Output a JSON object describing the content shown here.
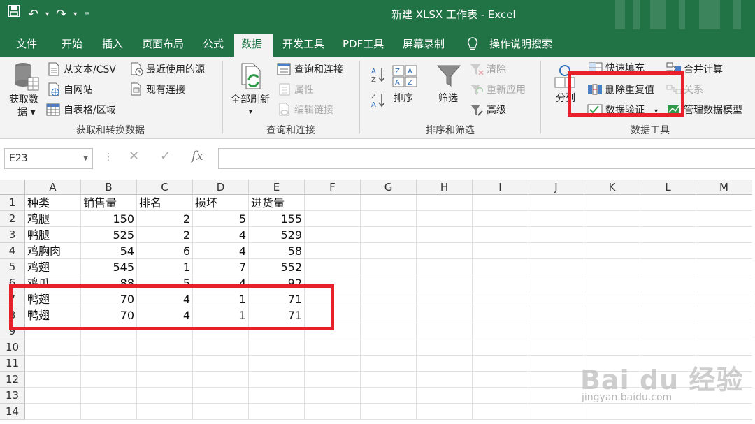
{
  "window": {
    "title": "新建 XLSX 工作表  -  Excel"
  },
  "tabs": [
    {
      "label": "文件"
    },
    {
      "label": "开始"
    },
    {
      "label": "插入"
    },
    {
      "label": "页面布局"
    },
    {
      "label": "公式"
    },
    {
      "label": "数据",
      "active": true
    },
    {
      "label": "开发工具"
    },
    {
      "label": "PDF工具"
    },
    {
      "label": "屏幕录制"
    },
    {
      "label": "操作说明搜索"
    }
  ],
  "ribbon": {
    "get_transform": {
      "get_data": "获取数",
      "get_data_2": "据 ▾",
      "from_text_csv": "从文本/CSV",
      "from_web": "自网站",
      "from_table": "自表格/区域",
      "recent_sources": "最近使用的源",
      "existing_connections": "现有连接",
      "group_label": "获取和转换数据"
    },
    "queries": {
      "refresh_all": "全部刷新",
      "refresh_dd": "▾",
      "queries_connections": "查询和连接",
      "properties": "属性",
      "edit_links": "编辑链接",
      "group_label": "查询和连接"
    },
    "sort_filter": {
      "sort": "排序",
      "filter": "筛选",
      "clear": "清除",
      "reapply": "重新应用",
      "advanced": "高级",
      "group_label": "排序和筛选"
    },
    "data_tools": {
      "split": "分列",
      "flash_fill": "快速填充",
      "remove_duplicates": "删除重复值",
      "data_validation": "数据验证",
      "data_validation_dd": "▾",
      "consolidate": "合并计算",
      "relationships": "关系",
      "manage_model": "管理数据模型",
      "group_label": "数据工具"
    }
  },
  "formula_bar": {
    "name_box": "E23",
    "cancel": "✕",
    "enter": "✓",
    "fx": "fx",
    "value": ""
  },
  "sheet": {
    "columns": [
      "A",
      "B",
      "C",
      "D",
      "E",
      "F",
      "G",
      "H",
      "I",
      "J",
      "K",
      "L",
      "M"
    ],
    "rows": [
      [
        "种类",
        "销售量",
        "排名",
        "损坏",
        "进货量"
      ],
      [
        "鸡腿",
        "150",
        "2",
        "5",
        "155"
      ],
      [
        "鸭腿",
        "525",
        "2",
        "4",
        "529"
      ],
      [
        "鸡胸肉",
        "54",
        "6",
        "4",
        "58"
      ],
      [
        "鸡翅",
        "545",
        "1",
        "7",
        "552"
      ],
      [
        "鸡爪",
        "88",
        "5",
        "4",
        "92"
      ],
      [
        "鸭翅",
        "70",
        "4",
        "1",
        "71"
      ],
      [
        "鸭翅",
        "70",
        "4",
        "1",
        "71"
      ],
      [
        "",
        "",
        "",
        "",
        ""
      ],
      [
        "",
        "",
        "",
        "",
        ""
      ],
      [
        "",
        "",
        "",
        "",
        ""
      ],
      [
        "",
        "",
        "",
        "",
        ""
      ],
      [
        "",
        "",
        "",
        "",
        ""
      ],
      [
        "",
        "",
        "",
        "",
        ""
      ]
    ],
    "row_numbers": [
      "1",
      "2",
      "3",
      "4",
      "5",
      "6",
      "7",
      "8",
      "9",
      "10",
      "11",
      "12",
      "13",
      "14"
    ]
  },
  "watermark": {
    "logo": "Bai du 经验",
    "url": "jingyan.baidu.com"
  },
  "colors": {
    "excel_green": "#217346",
    "highlight_red": "#e8202a"
  }
}
